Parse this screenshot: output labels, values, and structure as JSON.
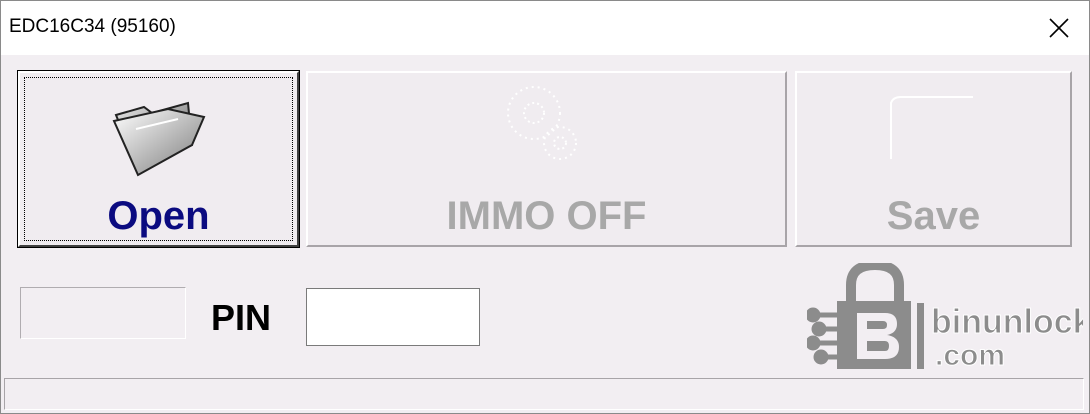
{
  "window": {
    "title": "EDC16C34 (95160)"
  },
  "toolbar": {
    "open_label": "Open",
    "immo_off_label": "IMMO OFF",
    "save_label": "Save",
    "open_enabled": true,
    "immo_off_enabled": false,
    "save_enabled": false
  },
  "form": {
    "pin_label": "PIN",
    "pin_value": "",
    "small_field_value": ""
  },
  "branding": {
    "logo_text_line1": "binunlock",
    "logo_text_line2": ".com"
  },
  "status": {
    "text": ""
  },
  "icons": {
    "open": "folder-open-icon",
    "immo": "gear-disabled-icon",
    "save": "save-disabled-icon",
    "close": "close-icon",
    "logo": "padlock-circuit-logo"
  },
  "colors": {
    "open_label": "#0b0b80",
    "disabled_label": "#a8a8a8",
    "window_bg": "#f2eef2",
    "logo_gray": "#8c8c8c"
  }
}
